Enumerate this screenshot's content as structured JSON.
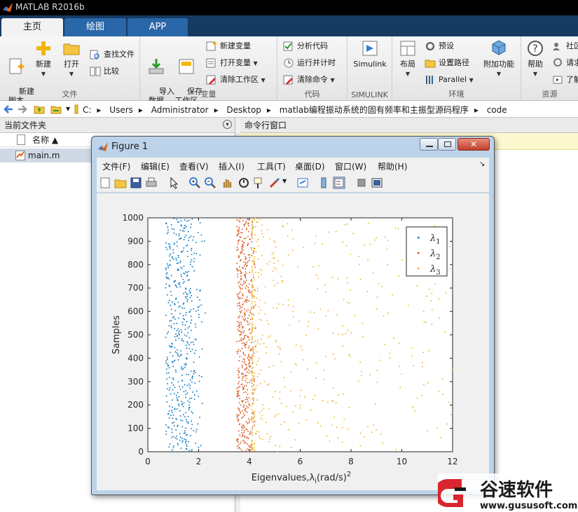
{
  "app": {
    "title": "MATLAB R2016b"
  },
  "tabs": [
    {
      "label": "主页",
      "active": true
    },
    {
      "label": "绘图",
      "active": false
    },
    {
      "label": "APP",
      "active": false
    }
  ],
  "ribbon": {
    "file": {
      "label": "文件",
      "new_script": "新建\n脚本",
      "new": "新建",
      "open": "打开",
      "find_files": "查找文件",
      "compare": "比较"
    },
    "variable": {
      "label": "变量",
      "import": "导入\n数据",
      "save": "保存\n工作区",
      "new_var": "新建变量",
      "open_var": "打开变量",
      "clear_ws": "清除工作区"
    },
    "code": {
      "label": "代码",
      "analyze": "分析代码",
      "run_time": "运行并计时",
      "clear_cmd": "清除命令"
    },
    "simulink": {
      "label": "SIMULINK",
      "simulink": "Simulink"
    },
    "env": {
      "label": "环境",
      "layout": "布局",
      "prefs": "预设",
      "set_path": "设置路径",
      "parallel": "Parallel",
      "addons": "附加功能"
    },
    "resources": {
      "label": "资源",
      "help": "帮助",
      "community": "社区",
      "request": "请求",
      "learn": "了解"
    }
  },
  "address": {
    "crumbs": [
      "C:",
      "Users",
      "Administrator",
      "Desktop",
      "matlab编程振动系统的固有频率和主振型源码程序",
      "code"
    ]
  },
  "left_panel": {
    "title": "当前文件夹",
    "col_name": "名称 ▲",
    "files": [
      "main.m"
    ]
  },
  "cmd_window": {
    "title": "命令行窗口"
  },
  "figure": {
    "title": "Figure 1",
    "menu": [
      "文件(F)",
      "编辑(E)",
      "查看(V)",
      "插入(I)",
      "工具(T)",
      "桌面(D)",
      "窗口(W)",
      "帮助(H)"
    ]
  },
  "chart_data": {
    "type": "scatter",
    "xlabel": "Eigenvalues,λi(rad/s)²",
    "ylabel": "Samples",
    "xlim": [
      0,
      12
    ],
    "ylim": [
      0,
      1000
    ],
    "xticks": [
      0,
      2,
      4,
      6,
      8,
      10,
      12
    ],
    "yticks": [
      0,
      100,
      200,
      300,
      400,
      500,
      600,
      700,
      800,
      900,
      1000
    ],
    "grid": false,
    "legend_position": "top-right",
    "points_per_series": 1000,
    "series": [
      {
        "name": "λ1",
        "color": "#0072bd",
        "dense_x_range": [
          0.7,
          2.3
        ],
        "x_mean": 1.3
      },
      {
        "name": "λ2",
        "color": "#d95319",
        "dense_x_range": [
          3.5,
          4.3
        ],
        "x_mean": 3.9
      },
      {
        "name": "λ3",
        "color": "#edb120",
        "dense_x_range": [
          4.0,
          11.9
        ],
        "x_mean": 4.9
      }
    ]
  },
  "watermark": {
    "brand": "谷速软件",
    "url": "www.gususoft.com"
  },
  "colors": {
    "accent": "#2a67a8",
    "tabbar": "#173a63",
    "figure_frame": "#bcd3ea"
  }
}
